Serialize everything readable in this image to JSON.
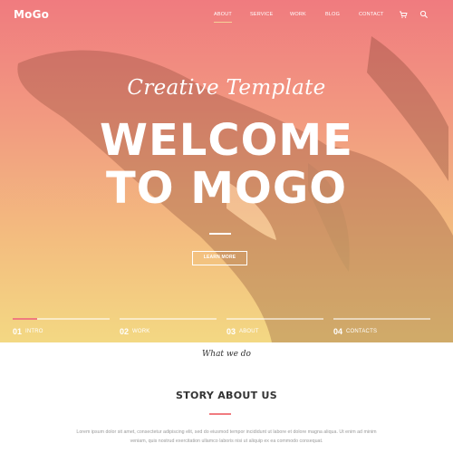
{
  "brand": {
    "logo": "MoGo"
  },
  "nav": {
    "items": [
      "ABOUT",
      "SERVICE",
      "WORK",
      "BLOG",
      "CONTACT"
    ],
    "active": "ABOUT",
    "icons": [
      "cart-icon",
      "search-icon"
    ]
  },
  "hero": {
    "script_text": "Creative Template",
    "title_line1": "WELCOME",
    "title_line2": "TO MOGO",
    "button_label": "LEARN MORE",
    "colors": {
      "top": "#f07b7f",
      "bottom": "#f3d883"
    }
  },
  "tabs": [
    {
      "num": "01",
      "label": "INTRO",
      "progress": 0.25
    },
    {
      "num": "02",
      "label": "WORK",
      "progress": 0
    },
    {
      "num": "03",
      "label": "ABOUT",
      "progress": 0
    },
    {
      "num": "04",
      "label": "CONTACTS",
      "progress": 0
    }
  ],
  "story": {
    "eyebrow": "What we do",
    "heading": "STORY ABOUT US",
    "paragraph_line1": "Lorem ipsum dolor sit amet, consectetur adipiscing elit, sed do eiusmod tempor incididunt ut labore et dolore magna aliqua. Ut enim ad minim",
    "paragraph_line2": "veniam, quis nostrud exercitation ullamco laboris nisi ut aliquip ex ea commodo consequat."
  },
  "accent_color": "#f07b7f"
}
